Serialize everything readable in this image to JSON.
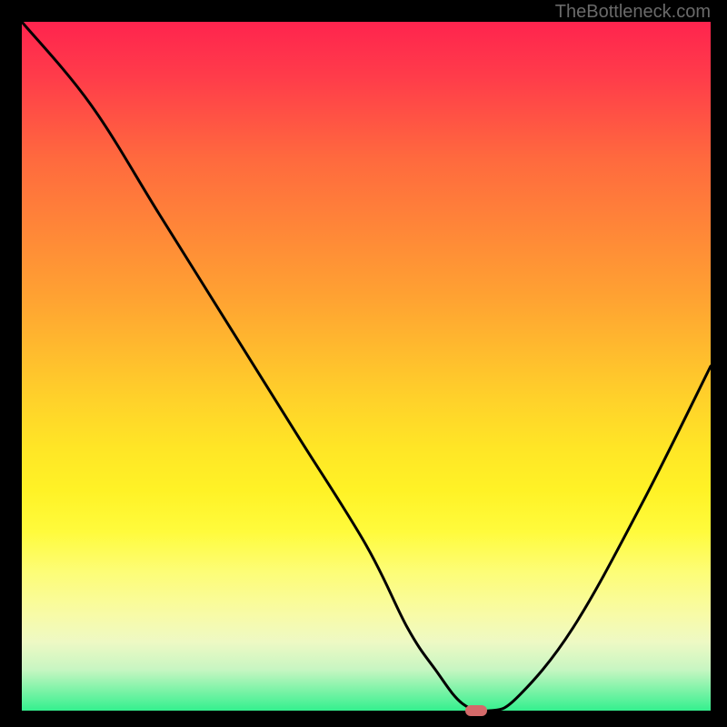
{
  "watermark": "TheBottleneck.com",
  "chart_data": {
    "type": "line",
    "title": "",
    "xlabel": "",
    "ylabel": "",
    "xlim": [
      0,
      100
    ],
    "ylim": [
      0,
      100
    ],
    "background": {
      "type": "vertical-gradient",
      "top_color": "#ff244e",
      "bottom_color": "#34f08e",
      "description": "red (high bottleneck) at top fading through orange/yellow to green (no bottleneck) at bottom"
    },
    "series": [
      {
        "name": "bottleneck-curve",
        "x": [
          0,
          10,
          20,
          30,
          40,
          50,
          56,
          60,
          64,
          68,
          72,
          80,
          90,
          100
        ],
        "y": [
          100,
          88,
          72,
          56,
          40,
          24,
          12,
          6,
          1,
          0,
          2,
          12,
          30,
          50
        ]
      }
    ],
    "marker": {
      "name": "optimal-point",
      "x": 66,
      "y": 0,
      "color": "#d46a6a"
    }
  }
}
